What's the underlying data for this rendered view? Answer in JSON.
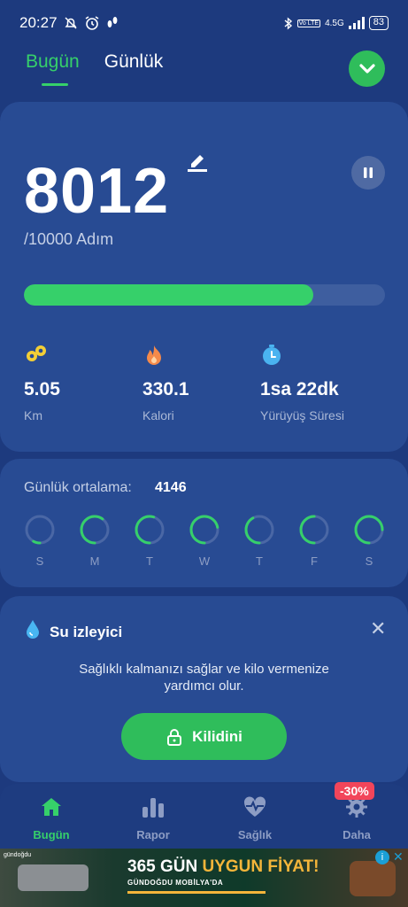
{
  "status": {
    "time": "20:27",
    "network": "4.5G",
    "battery": "83"
  },
  "tabs": [
    {
      "label": "Bugün",
      "active": true
    },
    {
      "label": "Günlük",
      "active": false
    }
  ],
  "main": {
    "steps": "8012",
    "goal": "/10000 Adım",
    "progress": 0.801
  },
  "stats": [
    {
      "icon": "distance-icon",
      "value": "5.05",
      "label": "Km",
      "color": "#f3cf36"
    },
    {
      "icon": "flame-icon",
      "value": "330.1",
      "label": "Kalori",
      "color": "#f58a4a"
    },
    {
      "icon": "timer-icon",
      "value": "1sa 22dk",
      "label": "Yürüyüş Süresi",
      "color": "#4ab3f0"
    }
  ],
  "weekly": {
    "avg_label": "Günlük ortalama:",
    "avg_value": "4146",
    "days": [
      {
        "label": "S",
        "fill": 0.08
      },
      {
        "label": "M",
        "fill": 0.6
      },
      {
        "label": "T",
        "fill": 0.55
      },
      {
        "label": "W",
        "fill": 0.72
      },
      {
        "label": "T",
        "fill": 0.42
      },
      {
        "label": "F",
        "fill": 0.5
      },
      {
        "label": "S",
        "fill": 0.75
      }
    ]
  },
  "water": {
    "title": "Su izleyici",
    "desc_line1": "Sağlıklı kalmanızı sağlar ve kilo vermenize",
    "desc_line2": "yardımcı olur.",
    "button": "Kilidini"
  },
  "nav": [
    {
      "label": "Bugün",
      "icon": "home-icon",
      "active": true
    },
    {
      "label": "Rapor",
      "icon": "bar-chart-icon",
      "active": false
    },
    {
      "label": "Sağlık",
      "icon": "heart-pulse-icon",
      "active": false
    },
    {
      "label": "Daha",
      "icon": "gear-icon",
      "active": false
    }
  ],
  "discount_badge": "-30%",
  "ad": {
    "title_a": "365 GÜN ",
    "title_b": "UYGUN FİYAT!",
    "subtitle": "GÜNDOĞDU MOBİLYA'DA",
    "brand": "gündoğdu"
  },
  "colors": {
    "accent": "#36d06a",
    "background": "#1d3a7e",
    "card": "#284b93"
  }
}
